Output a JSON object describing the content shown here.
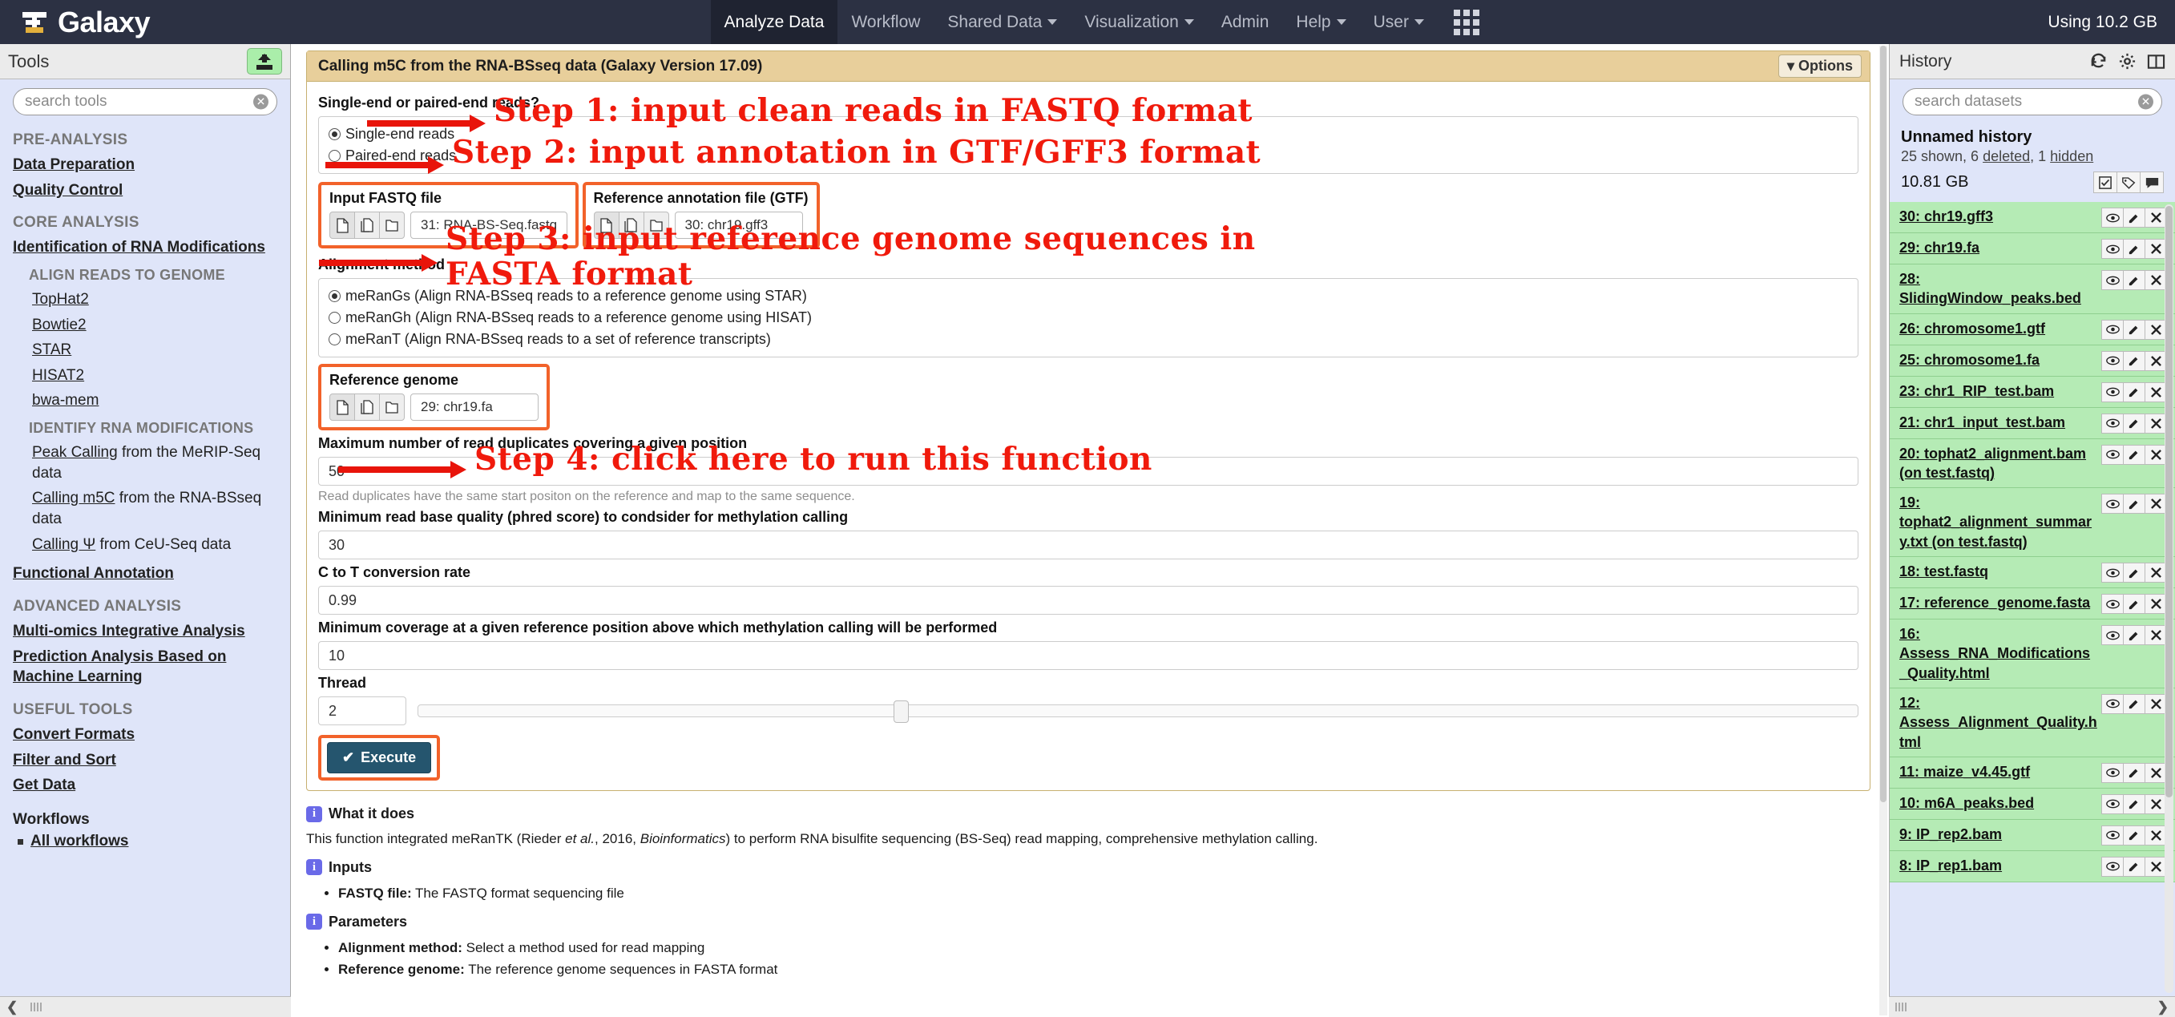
{
  "masthead": {
    "brand": "Galaxy",
    "nav": [
      {
        "label": "Analyze Data",
        "active": true,
        "caret": false
      },
      {
        "label": "Workflow",
        "active": false,
        "caret": false
      },
      {
        "label": "Shared Data",
        "active": false,
        "caret": true
      },
      {
        "label": "Visualization",
        "active": false,
        "caret": true
      },
      {
        "label": "Admin",
        "active": false,
        "caret": false
      },
      {
        "label": "Help",
        "active": false,
        "caret": true
      },
      {
        "label": "User",
        "active": false,
        "caret": true
      }
    ],
    "grid_icon": "apps-grid-icon",
    "using_space": "Using 10.2 GB"
  },
  "toolpanel": {
    "title": "Tools",
    "upload_icon": "upload-icon",
    "search": {
      "placeholder": "search tools",
      "clear_icon": "clear-icon"
    },
    "sections": [
      {
        "heading": "PRE-ANALYSIS",
        "items": [
          {
            "label": "Data Preparation"
          },
          {
            "label": "Quality Control"
          }
        ]
      },
      {
        "heading": "CORE ANALYSIS",
        "items": [
          {
            "label": "Identification of RNA Modifications"
          }
        ]
      },
      {
        "heading": "ALIGN READS TO GENOME",
        "sub": true,
        "items": [
          {
            "label": "TopHat2",
            "indent": true
          },
          {
            "label": "Bowtie2",
            "indent": true
          },
          {
            "label": "STAR",
            "indent": true
          },
          {
            "label": "HISAT2",
            "indent": true
          },
          {
            "label": "bwa-mem",
            "indent": true
          }
        ]
      },
      {
        "heading": "IDENTIFY RNA MODIFICATIONS",
        "sub": true,
        "items": [
          {
            "link": "Peak Calling",
            "rest": " from the MeRIP-Seq data",
            "indent": true
          },
          {
            "link": "Calling m5C",
            "rest": " from the RNA-BSseq data",
            "indent": true
          },
          {
            "link": "Calling Ψ",
            "rest": " from CeU-Seq data",
            "indent": true
          }
        ]
      },
      {
        "heading": "",
        "items": [
          {
            "label": "Functional Annotation"
          }
        ]
      },
      {
        "heading": "ADVANCED ANALYSIS",
        "items": [
          {
            "label": "Multi-omics Integrative Analysis"
          },
          {
            "label": "Prediction Analysis Based on Machine Learning"
          }
        ]
      },
      {
        "heading": "USEFUL TOOLS",
        "items": [
          {
            "label": "Convert Formats"
          },
          {
            "label": "Filter and Sort"
          },
          {
            "label": "Get Data"
          }
        ]
      }
    ],
    "workflows": {
      "heading": "Workflows",
      "items": [
        {
          "label": "All workflows"
        }
      ]
    }
  },
  "tool_form": {
    "title": "Calling m5C from the RNA-BSseq data (Galaxy Version 17.09)",
    "options_label": "Options",
    "fields": {
      "readtype_label": "Single-end or paired-end reads?",
      "readtype_options": [
        {
          "label": "Single-end reads",
          "selected": true
        },
        {
          "label": "Paired-end reads",
          "selected": false
        }
      ],
      "fastq_label": "Input FASTQ file",
      "fastq_value": "31: RNA-BS-Seq.fastq",
      "gtf_label": "Reference annotation file (GTF)",
      "gtf_value": "30: chr19.gff3",
      "alignment_label": "Alignment method",
      "alignment_options": [
        {
          "label": "meRanGs (Align RNA-BSseq reads to a reference genome using STAR)",
          "selected": true
        },
        {
          "label": "meRanGh (Align RNA-BSseq reads to a reference genome using HISAT)",
          "selected": false
        },
        {
          "label": "meRanT (Align RNA-BSseq reads to a set of reference transcripts)",
          "selected": false
        }
      ],
      "genome_label": "Reference genome",
      "genome_value": "29: chr19.fa",
      "maxdup_label": "Maximum number of read duplicates covering a given position",
      "maxdup_value": "50",
      "maxdup_help": "Read duplicates have the same start positon on the reference and map to the same sequence.",
      "minqual_label": "Minimum read base quality (phred score) to condsider for methylation calling",
      "minqual_value": "30",
      "conversion_label": "C to T conversion rate",
      "conversion_value": "0.99",
      "mincov_label": "Minimum coverage at a given reference position above which methylation calling will be performed",
      "mincov_value": "10",
      "thread_label": "Thread",
      "thread_value": "2"
    },
    "execute_label": "Execute",
    "execute_check": "check-icon",
    "dataset_icons": [
      "single-dataset-icon",
      "multiple-datasets-icon",
      "dataset-collection-icon"
    ]
  },
  "docs": {
    "what_heading": "What it does",
    "what_text_1": "This function integrated meRanTK (Rieder ",
    "what_italic_1": "et al.",
    "what_text_2": ", 2016, ",
    "what_italic_2": "Bioinformatics",
    "what_text_3": ") to perform RNA bisulfite sequencing (BS-Seq) read mapping, comprehensive methylation calling.",
    "inputs_heading": "Inputs",
    "inputs_items": [
      {
        "bold": "FASTQ file:",
        "rest": " The FASTQ format sequencing file"
      }
    ],
    "params_heading": "Parameters",
    "params_items": [
      {
        "bold": "Alignment method:",
        "rest": " Select a method used for read mapping"
      },
      {
        "bold": "Reference genome:",
        "rest": " The reference genome sequences in FASTA format"
      }
    ]
  },
  "history": {
    "title": "History",
    "icons": [
      "refresh-icon",
      "gear-icon",
      "columns-icon"
    ],
    "search": {
      "placeholder": "search datasets",
      "clear_icon": "clear-icon"
    },
    "name": "Unnamed history",
    "counts_shown": "25 shown, 6 ",
    "counts_deleted": "deleted",
    "counts_mid": ", 1 ",
    "counts_hidden": "hidden",
    "size": "10.81 GB",
    "action_icons": [
      "select-checkbox-icon",
      "tags-icon",
      "annotation-icon"
    ],
    "item_icons": [
      "eye-icon",
      "pencil-icon",
      "delete-icon"
    ],
    "datasets": [
      {
        "title": "30: chr19.gff3"
      },
      {
        "title": "29: chr19.fa"
      },
      {
        "title": "28: SlidingWindow_peaks.bed"
      },
      {
        "title": "26: chromosome1.gtf"
      },
      {
        "title": "25: chromosome1.fa"
      },
      {
        "title": "23: chr1_RIP_test.bam"
      },
      {
        "title": "21: chr1_input_test.bam"
      },
      {
        "title": "20: tophat2_alignment.bam (on test.fastq)"
      },
      {
        "title": "19: tophat2_alignment_summary.txt (on test.fastq)"
      },
      {
        "title": "18: test.fastq"
      },
      {
        "title": "17: reference_genome.fasta"
      },
      {
        "title": "16: Assess_RNA_Modifications_Quality.html"
      },
      {
        "title": "12: Assess_Alignment_Quality.html"
      },
      {
        "title": "11: maize_v4.45.gtf"
      },
      {
        "title": "10: m6A_peaks.bed"
      },
      {
        "title": "9: IP_rep2.bam"
      },
      {
        "title": "8: IP_rep1.bam"
      }
    ]
  },
  "annotations": [
    {
      "id": "step1",
      "text": "Step 1: input clean reads in FASTQ format"
    },
    {
      "id": "step2",
      "text": "Step 2: input annotation in GTF/GFF3 format"
    },
    {
      "id": "step3",
      "text": "Step 3: input reference genome sequences in\nFASTA format"
    },
    {
      "id": "step4",
      "text": "Step 4: click here to run this function"
    }
  ],
  "colors": {
    "masthead": "#2c3143",
    "annotation_red": "#f01a0c",
    "highlight_orange": "#f2622a",
    "dataset_green": "#b5ebb5",
    "form_header": "#e8cf9b",
    "execute_blue": "#25556e"
  }
}
